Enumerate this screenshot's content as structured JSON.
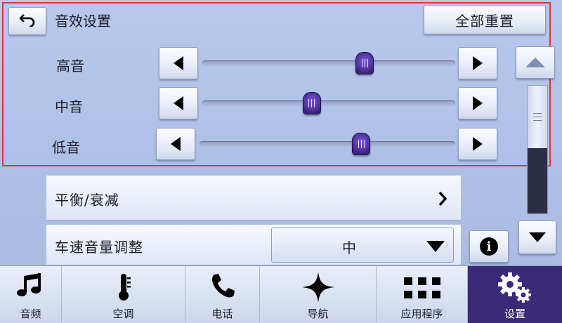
{
  "header": {
    "title": "音效设置",
    "reset_label": "全部重置"
  },
  "eq": [
    {
      "label": "高音",
      "level": 0.64
    },
    {
      "label": "中音",
      "level": 0.43
    },
    {
      "label": "低音",
      "level": 0.63
    }
  ],
  "icons": {
    "back": "back-arrow-icon",
    "decrease": "triangle-left-icon",
    "increase": "triangle-right-icon",
    "scroll_up": "triangle-up-icon",
    "scroll_down": "triangle-down-icon",
    "chevron": "chevron-right-icon",
    "info": "info-icon"
  },
  "scrollbar": {
    "position": 0.0,
    "visible_fraction": 0.49
  },
  "balance": {
    "label": "平衡/衰减"
  },
  "speed_volume": {
    "label": "车速音量调整",
    "value": "中"
  },
  "info_glyph": "i",
  "nav": [
    {
      "label": "音频",
      "icon": "music-note-icon",
      "active": false
    },
    {
      "label": "空调",
      "icon": "thermometer-icon",
      "active": false
    },
    {
      "label": "电话",
      "icon": "phone-icon",
      "active": false
    },
    {
      "label": "导航",
      "icon": "compass-star-icon",
      "active": false
    },
    {
      "label": "应用程序",
      "icon": "apps-grid-icon",
      "active": false
    },
    {
      "label": "设置",
      "icon": "gears-icon",
      "active": true
    }
  ],
  "colors": {
    "accent": "#3b2a78",
    "highlight_frame": "#e0343c",
    "background": "#b2c3e8"
  }
}
